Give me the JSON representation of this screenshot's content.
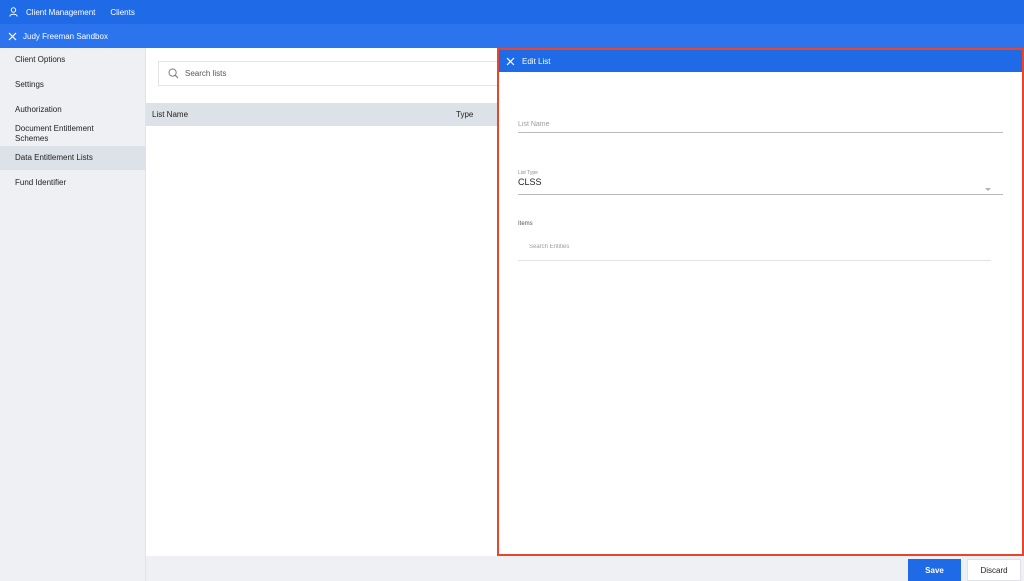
{
  "header": {
    "user_icon": "user-icon",
    "breadcrumb_1": "Client Management",
    "breadcrumb_2": "Clients"
  },
  "subheader": {
    "close_icon": "close-icon",
    "title": "Judy Freeman Sandbox"
  },
  "sidebar": {
    "items": [
      {
        "label": "Client Options"
      },
      {
        "label": "Settings"
      },
      {
        "label": "Authorization"
      },
      {
        "label": "Document Entitlement Schemes"
      },
      {
        "label": "Data Entitlement Lists",
        "active": true
      },
      {
        "label": "Fund Identifier"
      }
    ]
  },
  "lists": {
    "search_placeholder": "Search lists",
    "columns": [
      "List Name",
      "Type"
    ]
  },
  "edit_panel": {
    "title": "Edit List",
    "list_name_placeholder": "List Name",
    "list_type_label": "List Type",
    "list_type_value": "CLSS",
    "items_label": "Items",
    "entities_placeholder": "Search Entities"
  },
  "footer": {
    "save_label": "Save",
    "discard_label": "Discard"
  },
  "colors": {
    "primary": "#1f6ae6",
    "highlight_border": "#e8452c"
  }
}
